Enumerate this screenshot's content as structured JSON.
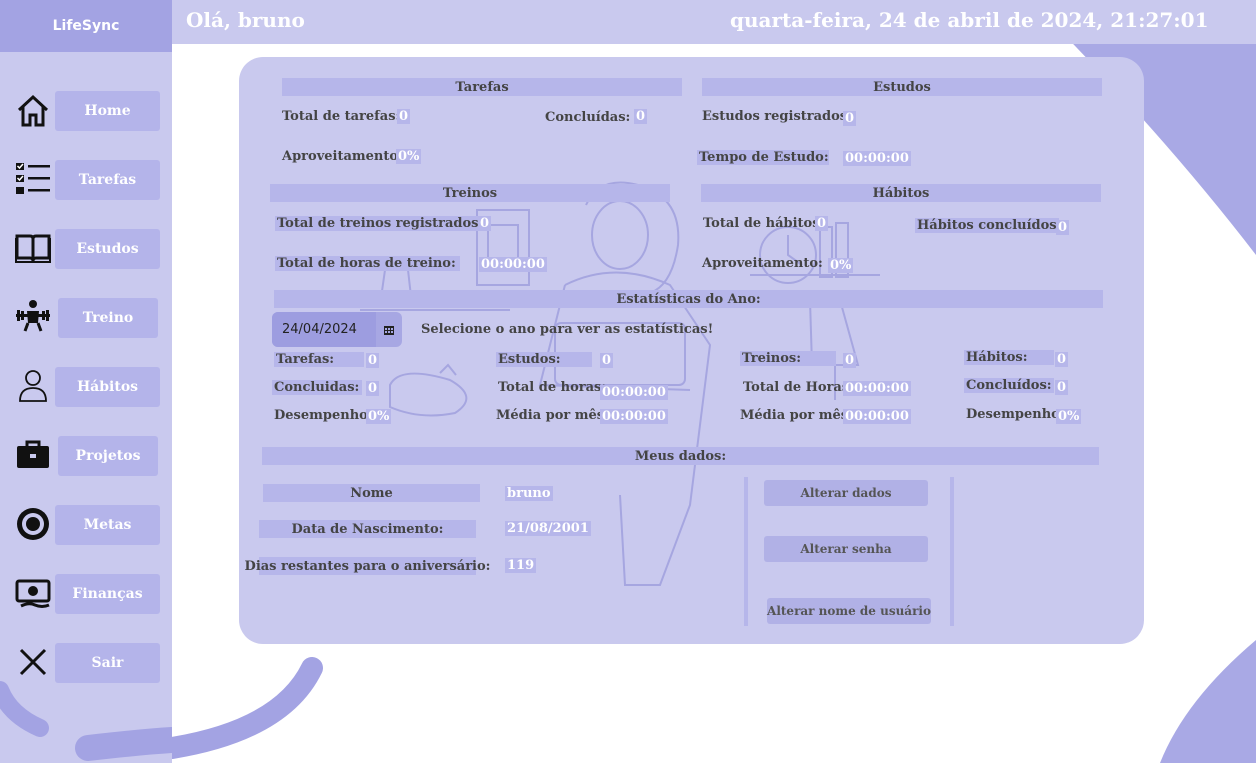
{
  "app": {
    "name": "LifeSync"
  },
  "header": {
    "greeting": "Olá, bruno",
    "datetime": "quarta-feira, 24 de abril de 2024, 21:27:01"
  },
  "sidebar": {
    "items": [
      {
        "label": "Home",
        "icon": "home-icon"
      },
      {
        "label": "Tarefas",
        "icon": "checklist-icon"
      },
      {
        "label": "Estudos",
        "icon": "book-icon"
      },
      {
        "label": "Treino",
        "icon": "workout-icon"
      },
      {
        "label": "Hábitos",
        "icon": "person-icon"
      },
      {
        "label": "Projetos",
        "icon": "briefcase-icon"
      },
      {
        "label": "Metas",
        "icon": "target-icon"
      },
      {
        "label": "Finanças",
        "icon": "money-icon"
      },
      {
        "label": "Sair",
        "icon": "close-icon"
      }
    ]
  },
  "tarefas": {
    "title": "Tarefas",
    "total_label": "Total de tarefas:",
    "total_value": "0",
    "concluidas_label": "Concluídas:",
    "concluidas_value": "0",
    "aproveitamento_label": "Aproveitamento:",
    "aproveitamento_value": "0%"
  },
  "estudos": {
    "title": "Estudos",
    "registrados_label": "Estudos registrados:",
    "registrados_value": "0",
    "tempo_label": "Tempo de Estudo:",
    "tempo_value": "00:00:00"
  },
  "treinos": {
    "title": "Treinos",
    "total_label": "Total de treinos registrados:",
    "total_value": "0",
    "horas_label": "Total de horas de treino:",
    "horas_value": "00:00:00"
  },
  "habitos": {
    "title": "Hábitos",
    "total_label": "Total de hábitos:",
    "total_value": "0",
    "concluidos_label": "Hábitos concluídos",
    "concluidos_value": "0",
    "aproveitamento_label": "Aproveitamento:",
    "aproveitamento_value": "0%"
  },
  "ano": {
    "title": "Estatísticas do Ano:",
    "date_value": "24/04/2024",
    "instruction": "Selecione o ano para ver as estatísticas!",
    "tarefas_label": "Tarefas:",
    "tarefas_value": "0",
    "tarefas_concluidas_label": "Concluidas:",
    "tarefas_concluidas_value": "0",
    "tarefas_desempenho_label": "Desempenho:",
    "tarefas_desempenho_value": "0%",
    "estudos_label": "Estudos:",
    "estudos_value": "0",
    "estudos_horas_label": "Total de horas:",
    "estudos_horas_value": "00:00:00",
    "estudos_media_label": "Média por mês:",
    "estudos_media_value": "00:00:00",
    "treinos_label": "Treinos:",
    "treinos_value": "0",
    "treinos_horas_label": "Total de Horas:",
    "treinos_horas_value": "00:00:00",
    "treinos_media_label": "Média por mês:",
    "treinos_media_value": "00:00:00",
    "habitos_label": "Hábitos:",
    "habitos_value": "0",
    "habitos_concluidos_label": "Concluídos:",
    "habitos_concluidos_value": "0",
    "habitos_desempenho_label": "Desempenho:",
    "habitos_desempenho_value": "0%"
  },
  "meus_dados": {
    "title": "Meus dados:",
    "nome_label": "Nome",
    "nome_value": "bruno",
    "nascimento_label": "Data de Nascimento:",
    "nascimento_value": "21/08/2001",
    "dias_label": "Dias restantes para o aniversário:",
    "dias_value": "119",
    "alterar_dados": "Alterar dados",
    "alterar_senha": "Alterar senha",
    "alterar_usuario": "Alterar nome de usuário"
  },
  "colors": {
    "sidebar": "#c9c9ee",
    "accent": "#a3a3e3",
    "panel": "#c9c9ee",
    "section": "#b6b6ea"
  }
}
